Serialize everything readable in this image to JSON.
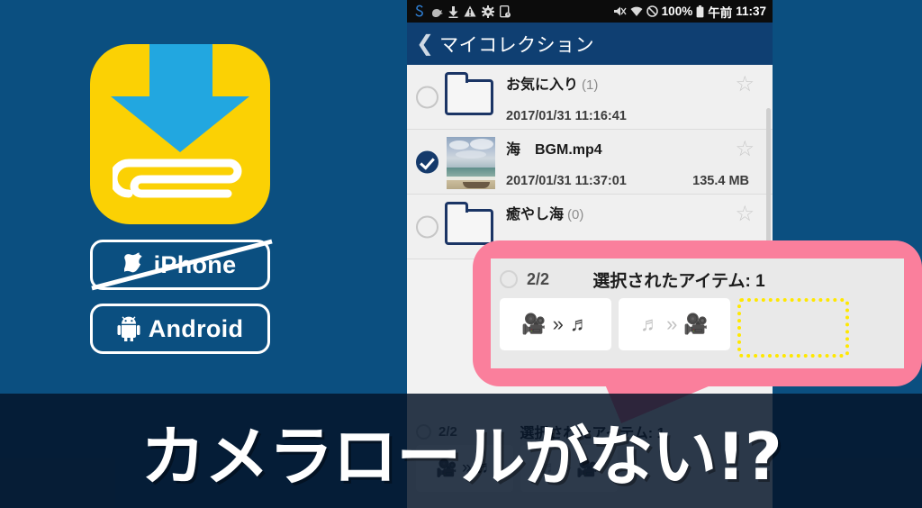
{
  "theme": {
    "background": "#0b4f80",
    "icon_yellow": "#fbd104",
    "arrow_blue": "#22a7e0",
    "callout_pink": "#fa7f9c",
    "highlight_yellow": "#ffe800",
    "appbar_navy": "#0f3f72"
  },
  "branding": {
    "app_icon_name": "download-clip-app-icon",
    "badges": [
      {
        "name": "iphone-badge",
        "label": "iPhone",
        "icon": "apple-logo-icon",
        "struck_through": true
      },
      {
        "name": "android-badge",
        "label": "Android",
        "icon": "android-robot-icon",
        "struck_through": false
      }
    ]
  },
  "phone": {
    "status_bar": {
      "left_icons": [
        "s-logo-icon",
        "hand-gesture-icon",
        "download-arrow-icon",
        "warning-triangle-icon",
        "gear-icon",
        "document-sync-icon"
      ],
      "right_icons": [
        "mute-icon",
        "wifi-icon",
        "no-sim-icon",
        "battery-icon"
      ],
      "battery": "100%",
      "meridiem": "午前",
      "time": "11:37"
    },
    "app_bar": {
      "back_icon": "chevron-left-icon",
      "title": "マイコレクション"
    },
    "list": [
      {
        "type": "folder",
        "title": "お気に入り",
        "count": "(1)",
        "date": "2017/01/31 11:16:41",
        "size": "",
        "selected": false,
        "star_icon": "star-outline-icon"
      },
      {
        "type": "video",
        "title": "海　BGM.mp4",
        "count": "",
        "date": "2017/01/31 11:37:01",
        "size": "135.4 MB",
        "selected": true,
        "star_icon": "star-outline-icon"
      },
      {
        "type": "folder",
        "title": "癒やし海",
        "count": "(0)",
        "date": "",
        "size": "",
        "selected": false,
        "star_icon": "star-outline-icon"
      }
    ],
    "toolbar": {
      "page": "2/2",
      "selected_label": "選択されたアイテム: 1",
      "buttons": [
        {
          "name": "video-to-audio-button",
          "left_icon": "movie-camera-icon",
          "arrow": "»",
          "right_icon": "music-note-icon",
          "enabled": true
        },
        {
          "name": "audio-to-video-button",
          "left_icon": "music-note-icon",
          "arrow": "»",
          "right_icon": "movie-camera-icon",
          "enabled": false
        },
        {
          "name": "missing-camera-roll-button",
          "left_icon": "",
          "arrow": "",
          "right_icon": "",
          "enabled": false
        }
      ]
    }
  },
  "callout": {
    "name": "highlight-callout",
    "page": "2/2",
    "selected_label": "選択されたアイテム: 1",
    "buttons": [
      {
        "name": "video-to-audio-button",
        "left_icon": "🎥",
        "arrow": "»",
        "right_icon": "♬",
        "state": "enabled"
      },
      {
        "name": "audio-to-video-button",
        "left_icon": "♬",
        "arrow": "»",
        "right_icon": "🎥",
        "state": "disabled"
      },
      {
        "name": "missing-slot",
        "left_icon": "",
        "arrow": "",
        "right_icon": "",
        "state": "highlighted-empty"
      }
    ]
  },
  "banner": {
    "headline": "カメラロールがない!?"
  },
  "glyphs": {
    "camera": "🎥",
    "music": "♬",
    "arrows": "»",
    "star": "☆",
    "chevron_left": "❮",
    "apple": "",
    "android": "🤖"
  }
}
